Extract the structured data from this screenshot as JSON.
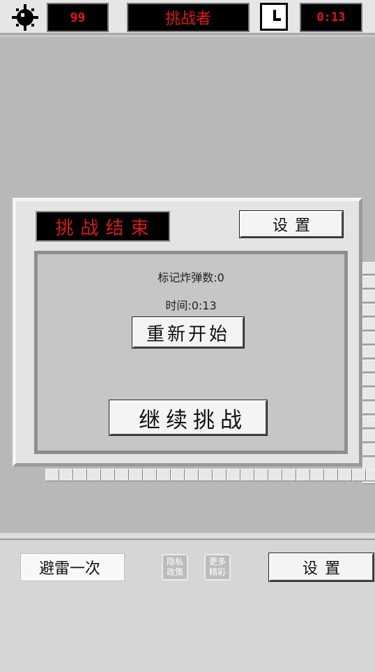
{
  "header": {
    "mine_icon": "mine-icon",
    "mine_count": "99",
    "mode_title": "挑战者",
    "clock_icon": "clock-icon",
    "timer": "0:13"
  },
  "dialog": {
    "title": "挑战结束",
    "settings_label": "设置",
    "flagged_mines": "标记炸弹数:0",
    "time": "时间:0:13",
    "restart_label": "重新开始",
    "continue_label": "继续挑战"
  },
  "bottom": {
    "dodge_label": "避雷一次",
    "privacy_label": "隐私政策",
    "more_label": "更多精彩",
    "settings_label": "设置"
  },
  "colors": {
    "lcd_text": "#e01818",
    "lcd_background": "#000000",
    "game_area": "#b8b8b8"
  }
}
